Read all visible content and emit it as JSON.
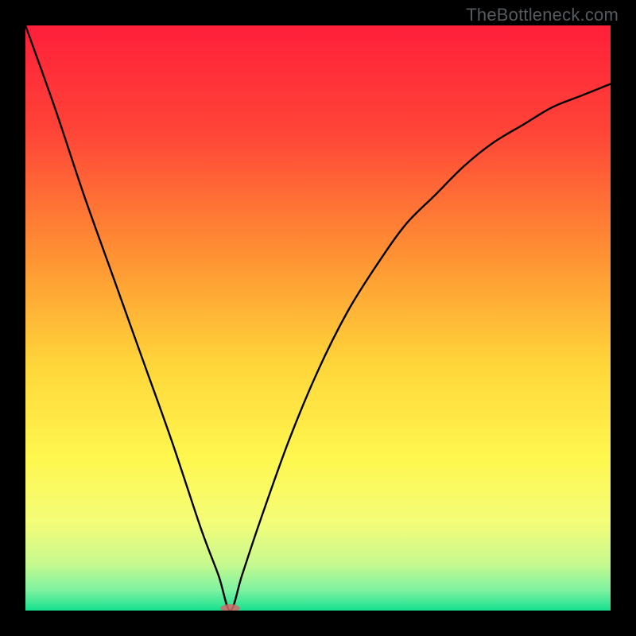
{
  "watermark": "TheBottleneck.com",
  "chart_data": {
    "type": "line",
    "title": "",
    "xlabel": "",
    "ylabel": "",
    "xlim": [
      0,
      1
    ],
    "ylim": [
      0,
      1
    ],
    "min_x": 0.35,
    "min_marker": {
      "x": 0.35,
      "color": "#d46a6a"
    },
    "series": [
      {
        "name": "curve",
        "x": [
          0.0,
          0.05,
          0.1,
          0.15,
          0.2,
          0.25,
          0.3,
          0.33,
          0.35,
          0.37,
          0.4,
          0.45,
          0.5,
          0.55,
          0.6,
          0.65,
          0.7,
          0.75,
          0.8,
          0.85,
          0.9,
          0.95,
          1.0
        ],
        "y": [
          1.0,
          0.86,
          0.71,
          0.57,
          0.43,
          0.29,
          0.14,
          0.06,
          0.0,
          0.06,
          0.15,
          0.29,
          0.41,
          0.51,
          0.59,
          0.66,
          0.71,
          0.76,
          0.8,
          0.83,
          0.86,
          0.88,
          0.9
        ]
      }
    ],
    "gradient_stops": [
      {
        "offset": 0.0,
        "color": "#ff1f3a"
      },
      {
        "offset": 0.18,
        "color": "#ff4438"
      },
      {
        "offset": 0.4,
        "color": "#ff9433"
      },
      {
        "offset": 0.58,
        "color": "#ffd63a"
      },
      {
        "offset": 0.74,
        "color": "#fff74f"
      },
      {
        "offset": 0.85,
        "color": "#f4fd78"
      },
      {
        "offset": 0.92,
        "color": "#c7f98f"
      },
      {
        "offset": 0.965,
        "color": "#7ef2a0"
      },
      {
        "offset": 1.0,
        "color": "#16e08f"
      }
    ]
  }
}
